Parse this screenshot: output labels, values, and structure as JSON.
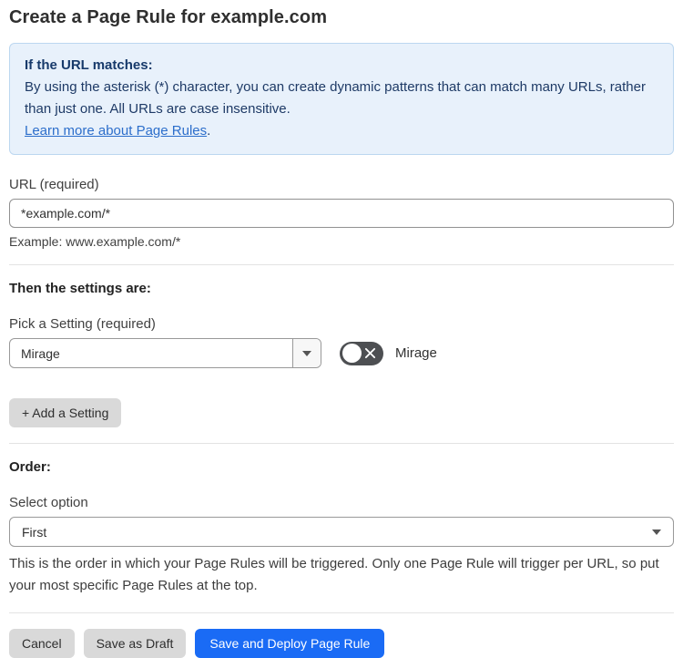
{
  "page": {
    "title": "Create a Page Rule for example.com"
  },
  "info_box": {
    "heading": "If the URL matches:",
    "body": "By using the asterisk (*) character, you can create dynamic patterns that can match many URLs, rather than just one. All URLs are case insensitive.",
    "link_text": "Learn more about Page Rules",
    "link_suffix": "."
  },
  "url_field": {
    "label": "URL (required)",
    "value": "*example.com/*",
    "helper": "Example: www.example.com/*"
  },
  "settings_section": {
    "heading": "Then the settings are:",
    "picker_label": "Pick a Setting (required)",
    "picker_value": "Mirage",
    "toggle_label": "Mirage",
    "toggle_state": "off",
    "add_button_label": "+ Add a Setting"
  },
  "order_section": {
    "heading": "Order:",
    "select_label": "Select option",
    "select_value": "First",
    "helper": "This is the order in which your Page Rules will be triggered. Only one Page Rule will trigger per URL, so put your most specific Page Rules at the top."
  },
  "actions": {
    "cancel_label": "Cancel",
    "save_draft_label": "Save as Draft",
    "save_deploy_label": "Save and Deploy Page Rule"
  },
  "colors": {
    "accent_blue": "#1a6bf5",
    "info_bg": "#e8f1fb",
    "info_border": "#bcd7f0",
    "info_text": "#1e3a66",
    "link_blue": "#2c6ecb",
    "toggle_off_bg": "#4d4f52",
    "gray_button_bg": "#d9d9d9"
  }
}
